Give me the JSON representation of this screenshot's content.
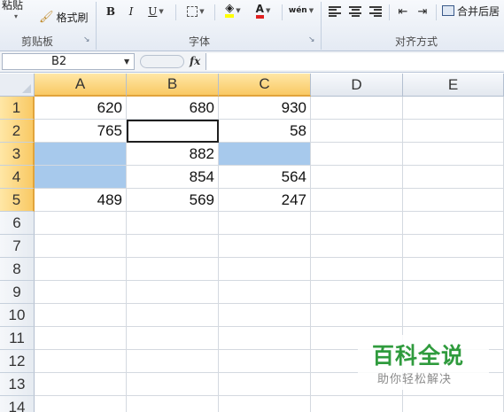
{
  "ribbon": {
    "clipboard": {
      "paste_label": "粘贴",
      "format_painter_label": "格式刷",
      "group_label": "剪贴板"
    },
    "font": {
      "bold": "B",
      "italic": "I",
      "underline": "U",
      "font_color_glyph": "A",
      "phonetic_glyph": "wén",
      "group_label": "字体"
    },
    "alignment": {
      "merge_center_label": "合并后居",
      "group_label": "对齐方式"
    }
  },
  "formula_bar": {
    "name_box": "B2",
    "fx_label": "fx",
    "value": ""
  },
  "sheet": {
    "columns": [
      "A",
      "B",
      "C",
      "D",
      "E"
    ],
    "rows": [
      "1",
      "2",
      "3",
      "4",
      "5",
      "6",
      "7",
      "8",
      "9",
      "10",
      "11",
      "12",
      "13",
      "14"
    ],
    "cells": [
      [
        "620",
        "680",
        "930",
        "",
        ""
      ],
      [
        "765",
        "",
        "58",
        "",
        ""
      ],
      [
        "",
        "882",
        "",
        "",
        ""
      ],
      [
        "",
        "854",
        "564",
        "",
        ""
      ],
      [
        "489",
        "569",
        "247",
        "",
        ""
      ]
    ],
    "active_cell": "B2",
    "highlight_color": "#a7c9ec",
    "selected_header_color": "#f9c964"
  },
  "watermark": {
    "title": "百科全说",
    "subtitle": "助你轻松解决"
  }
}
